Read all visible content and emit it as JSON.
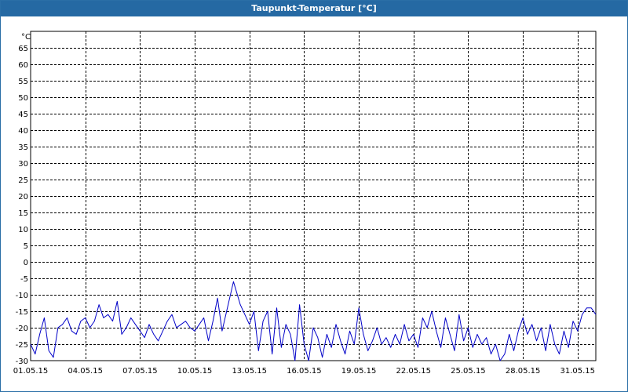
{
  "window": {
    "title": "Taupunkt-Temperatur [°C]"
  },
  "chart_data": {
    "type": "line",
    "title": "Taupunkt-Temperatur [°C]",
    "ylabel": "°C",
    "xlabel": "",
    "ylim": [
      -30,
      70
    ],
    "xlim": [
      "2015-05-01",
      "2015-06-01"
    ],
    "grid": true,
    "y_ticks": [
      65,
      60,
      55,
      50,
      45,
      40,
      35,
      30,
      25,
      20,
      15,
      10,
      5,
      0,
      -5,
      -10,
      -15,
      -20,
      -25,
      -30
    ],
    "x_ticks": [
      {
        "date": "2015-05-01",
        "label": "01.05.15"
      },
      {
        "date": "2015-05-04",
        "label": "04.05.15"
      },
      {
        "date": "2015-05-07",
        "label": "07.05.15"
      },
      {
        "date": "2015-05-10",
        "label": "10.05.15"
      },
      {
        "date": "2015-05-13",
        "label": "13.05.15"
      },
      {
        "date": "2015-05-16",
        "label": "16.05.15"
      },
      {
        "date": "2015-05-19",
        "label": "19.05.15"
      },
      {
        "date": "2015-05-22",
        "label": "22.05.15"
      },
      {
        "date": "2015-05-25",
        "label": "25.05.15"
      },
      {
        "date": "2015-05-28",
        "label": "28.05.15"
      },
      {
        "date": "2015-05-31",
        "label": "31.05.15"
      }
    ],
    "series": [
      {
        "color": "#0000c8",
        "points": [
          [
            "2015-05-01 00:00",
            -25
          ],
          [
            "2015-05-01 06:00",
            -28
          ],
          [
            "2015-05-01 12:00",
            -22
          ],
          [
            "2015-05-01 18:00",
            -17
          ],
          [
            "2015-05-02 00:00",
            -27
          ],
          [
            "2015-05-02 06:00",
            -29
          ],
          [
            "2015-05-02 12:00",
            -20
          ],
          [
            "2015-05-02 18:00",
            -19
          ],
          [
            "2015-05-03 00:00",
            -17
          ],
          [
            "2015-05-03 06:00",
            -21
          ],
          [
            "2015-05-03 12:00",
            -22
          ],
          [
            "2015-05-03 18:00",
            -18
          ],
          [
            "2015-05-04 00:00",
            -17
          ],
          [
            "2015-05-04 06:00",
            -20
          ],
          [
            "2015-05-04 12:00",
            -18
          ],
          [
            "2015-05-04 18:00",
            -13
          ],
          [
            "2015-05-05 00:00",
            -17
          ],
          [
            "2015-05-05 06:00",
            -16
          ],
          [
            "2015-05-05 12:00",
            -18
          ],
          [
            "2015-05-05 18:00",
            -12
          ],
          [
            "2015-05-06 00:00",
            -22
          ],
          [
            "2015-05-06 06:00",
            -20
          ],
          [
            "2015-05-06 12:00",
            -17
          ],
          [
            "2015-05-06 18:00",
            -19
          ],
          [
            "2015-05-07 00:00",
            -21
          ],
          [
            "2015-05-07 06:00",
            -23
          ],
          [
            "2015-05-07 12:00",
            -19
          ],
          [
            "2015-05-07 18:00",
            -22
          ],
          [
            "2015-05-08 00:00",
            -24
          ],
          [
            "2015-05-08 06:00",
            -21
          ],
          [
            "2015-05-08 12:00",
            -18
          ],
          [
            "2015-05-08 18:00",
            -16
          ],
          [
            "2015-05-09 00:00",
            -20
          ],
          [
            "2015-05-09 06:00",
            -19
          ],
          [
            "2015-05-09 12:00",
            -18
          ],
          [
            "2015-05-09 18:00",
            -20
          ],
          [
            "2015-05-10 00:00",
            -21
          ],
          [
            "2015-05-10 06:00",
            -19
          ],
          [
            "2015-05-10 12:00",
            -17
          ],
          [
            "2015-05-10 18:00",
            -24
          ],
          [
            "2015-05-11 00:00",
            -18
          ],
          [
            "2015-05-11 06:00",
            -11
          ],
          [
            "2015-05-11 12:00",
            -21
          ],
          [
            "2015-05-11 18:00",
            -15
          ],
          [
            "2015-05-12 00:00",
            -9
          ],
          [
            "2015-05-12 03:00",
            -6
          ],
          [
            "2015-05-12 12:00",
            -13
          ],
          [
            "2015-05-12 18:00",
            -16
          ],
          [
            "2015-05-13 00:00",
            -19
          ],
          [
            "2015-05-13 06:00",
            -15
          ],
          [
            "2015-05-13 12:00",
            -27
          ],
          [
            "2015-05-13 18:00",
            -18
          ],
          [
            "2015-05-14 00:00",
            -15
          ],
          [
            "2015-05-14 06:00",
            -28
          ],
          [
            "2015-05-14 12:00",
            -14
          ],
          [
            "2015-05-14 18:00",
            -26
          ],
          [
            "2015-05-15 00:00",
            -19
          ],
          [
            "2015-05-15 06:00",
            -22
          ],
          [
            "2015-05-15 12:00",
            -30
          ],
          [
            "2015-05-15 18:00",
            -13
          ],
          [
            "2015-05-16 00:00",
            -25
          ],
          [
            "2015-05-16 06:00",
            -30
          ],
          [
            "2015-05-16 12:00",
            -20
          ],
          [
            "2015-05-16 18:00",
            -23
          ],
          [
            "2015-05-17 00:00",
            -29
          ],
          [
            "2015-05-17 06:00",
            -22
          ],
          [
            "2015-05-17 12:00",
            -26
          ],
          [
            "2015-05-17 18:00",
            -19
          ],
          [
            "2015-05-18 00:00",
            -24
          ],
          [
            "2015-05-18 06:00",
            -28
          ],
          [
            "2015-05-18 12:00",
            -21
          ],
          [
            "2015-05-18 18:00",
            -25
          ],
          [
            "2015-05-19 00:00",
            -14
          ],
          [
            "2015-05-19 06:00",
            -22
          ],
          [
            "2015-05-19 12:00",
            -27
          ],
          [
            "2015-05-19 18:00",
            -24
          ],
          [
            "2015-05-20 00:00",
            -20
          ],
          [
            "2015-05-20 06:00",
            -25
          ],
          [
            "2015-05-20 12:00",
            -23
          ],
          [
            "2015-05-20 18:00",
            -26
          ],
          [
            "2015-05-21 00:00",
            -22
          ],
          [
            "2015-05-21 06:00",
            -25
          ],
          [
            "2015-05-21 12:00",
            -19
          ],
          [
            "2015-05-21 18:00",
            -24
          ],
          [
            "2015-05-22 00:00",
            -22
          ],
          [
            "2015-05-22 06:00",
            -26
          ],
          [
            "2015-05-22 12:00",
            -17
          ],
          [
            "2015-05-22 18:00",
            -20
          ],
          [
            "2015-05-23 00:00",
            -15
          ],
          [
            "2015-05-23 06:00",
            -21
          ],
          [
            "2015-05-23 12:00",
            -26
          ],
          [
            "2015-05-23 18:00",
            -17
          ],
          [
            "2015-05-24 00:00",
            -22
          ],
          [
            "2015-05-24 06:00",
            -27
          ],
          [
            "2015-05-24 12:00",
            -16
          ],
          [
            "2015-05-24 18:00",
            -24
          ],
          [
            "2015-05-25 00:00",
            -20
          ],
          [
            "2015-05-25 06:00",
            -26
          ],
          [
            "2015-05-25 12:00",
            -22
          ],
          [
            "2015-05-25 18:00",
            -25
          ],
          [
            "2015-05-26 00:00",
            -23
          ],
          [
            "2015-05-26 06:00",
            -28
          ],
          [
            "2015-05-26 12:00",
            -25
          ],
          [
            "2015-05-26 18:00",
            -30
          ],
          [
            "2015-05-27 00:00",
            -28
          ],
          [
            "2015-05-27 06:00",
            -22
          ],
          [
            "2015-05-27 12:00",
            -27
          ],
          [
            "2015-05-27 18:00",
            -21
          ],
          [
            "2015-05-28 00:00",
            -17
          ],
          [
            "2015-05-28 06:00",
            -22
          ],
          [
            "2015-05-28 12:00",
            -19
          ],
          [
            "2015-05-28 18:00",
            -24
          ],
          [
            "2015-05-29 00:00",
            -20
          ],
          [
            "2015-05-29 06:00",
            -27
          ],
          [
            "2015-05-29 12:00",
            -19
          ],
          [
            "2015-05-29 18:00",
            -25
          ],
          [
            "2015-05-30 00:00",
            -28
          ],
          [
            "2015-05-30 06:00",
            -21
          ],
          [
            "2015-05-30 12:00",
            -26
          ],
          [
            "2015-05-30 18:00",
            -18
          ],
          [
            "2015-05-31 00:00",
            -21
          ],
          [
            "2015-05-31 06:00",
            -16
          ],
          [
            "2015-05-31 12:00",
            -14
          ],
          [
            "2015-05-31 18:00",
            -14
          ],
          [
            "2015-06-01 00:00",
            -16
          ]
        ]
      }
    ]
  }
}
